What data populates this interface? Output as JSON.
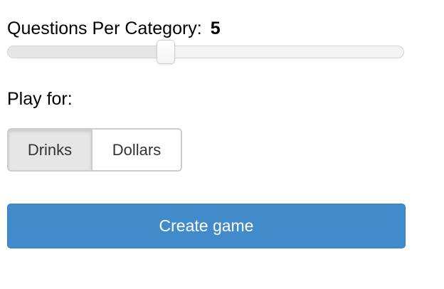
{
  "questions_per_category": {
    "label": "Questions Per Category:",
    "value": "5",
    "slider_fraction": 0.4
  },
  "play_for": {
    "label": "Play for:",
    "options": [
      "Drinks",
      "Dollars"
    ],
    "selected": "Drinks"
  },
  "create_button": {
    "label": "Create game"
  },
  "colors": {
    "primary": "#428bca",
    "toggle_active_bg": "#e6e6e6",
    "border": "#cccccc"
  }
}
